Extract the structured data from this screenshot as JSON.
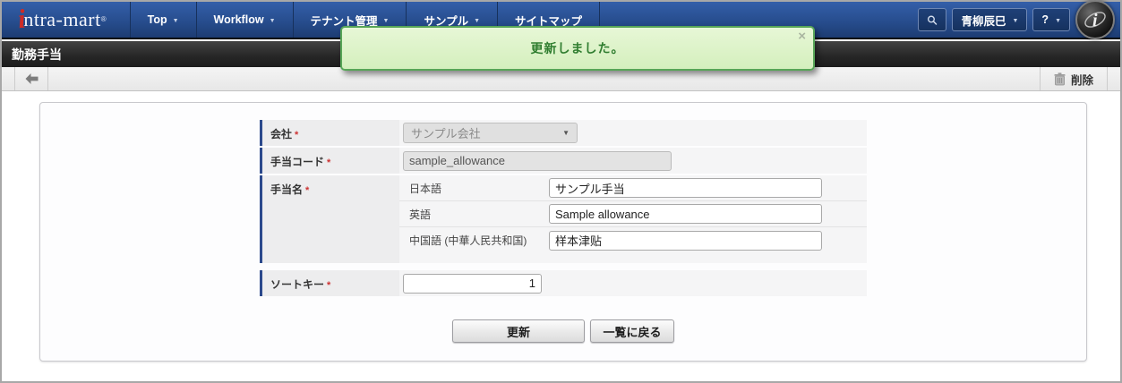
{
  "nav": {
    "brand": {
      "i_glyph": "i",
      "name": "ntra-mart",
      "registered": "®"
    },
    "caret": "▼",
    "items": [
      {
        "label": "Top"
      },
      {
        "label": "Workflow"
      },
      {
        "label": "テナント管理"
      },
      {
        "label": "サンプル"
      },
      {
        "label": "サイトマップ"
      }
    ],
    "search_icon": "magnifier",
    "user_label": "青柳辰巳",
    "help_label": "?"
  },
  "page": {
    "title": "勤務手当"
  },
  "toast": {
    "message": "更新しました。",
    "close_icon": "×"
  },
  "toolbar": {
    "back_icon": "left-arrow",
    "delete_icon": "trash",
    "delete_label": "削除"
  },
  "form": {
    "company": {
      "label": "会社",
      "required": "*",
      "value": "サンプル会社",
      "control": "select-disabled",
      "select_caret": "▼"
    },
    "code": {
      "label": "手当コード",
      "required": "*",
      "value": "sample_allowance",
      "control": "input-disabled"
    },
    "name": {
      "label": "手当名",
      "required": "*",
      "sub_rows": [
        {
          "lang_label": "日本語",
          "value": "サンプル手当"
        },
        {
          "lang_label": "英語",
          "value": "Sample allowance"
        },
        {
          "lang_label": "中国語 (中華人民共和国)",
          "value": "样本津贴"
        }
      ]
    },
    "sort_key": {
      "label": "ソートキー",
      "required": "*",
      "value": "1"
    }
  },
  "actions": {
    "update_label": "更新",
    "back_label": "一覧に戻る"
  },
  "colors": {
    "nav_blue_top": "#345fa9",
    "nav_blue_bottom": "#1d3c72",
    "title_bar": "#262626",
    "label_bar_blue": "#2c4a8c",
    "toast_border": "#57a557",
    "toast_bg": "#ddf2c6",
    "toast_text": "#2f7d2f",
    "required_red": "#cc3333",
    "brand_red": "#cf2b25"
  }
}
